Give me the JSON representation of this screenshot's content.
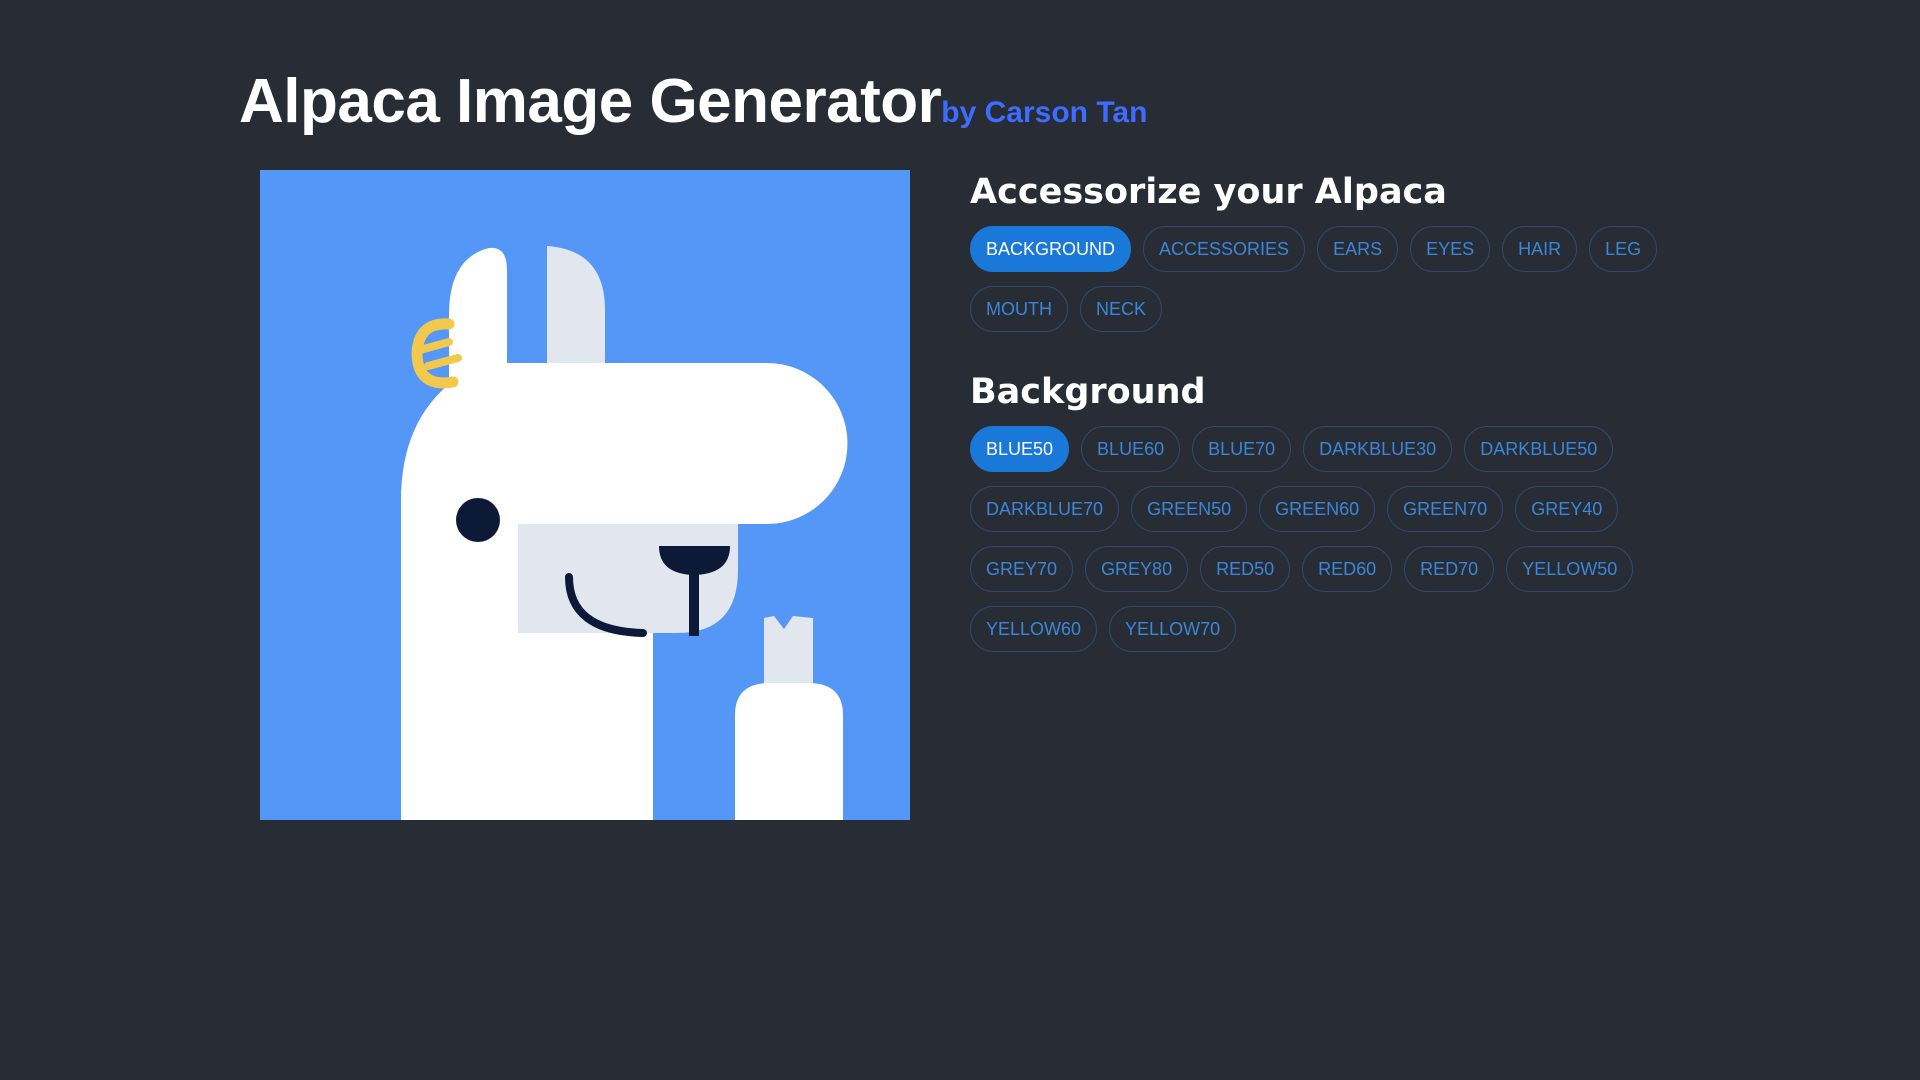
{
  "header": {
    "title": "Alpaca Image Generator",
    "author": "by Carson Tan"
  },
  "preview": {
    "background_color": "#5597f7",
    "accessory_icon": "earring-icon"
  },
  "accessorize": {
    "title": "Accessorize your Alpaca",
    "options": [
      "BACKGROUND",
      "ACCESSORIES",
      "EARS",
      "EYES",
      "HAIR",
      "LEG",
      "MOUTH",
      "NECK"
    ],
    "selected": "BACKGROUND"
  },
  "background": {
    "title": "Background",
    "options": [
      "BLUE50",
      "BLUE60",
      "BLUE70",
      "DARKBLUE30",
      "DARKBLUE50",
      "DARKBLUE70",
      "GREEN50",
      "GREEN60",
      "GREEN70",
      "GREY40",
      "GREY70",
      "GREY80",
      "RED50",
      "RED60",
      "RED70",
      "YELLOW50",
      "YELLOW60",
      "YELLOW70"
    ],
    "selected": "BLUE50"
  },
  "colors": {
    "page_background": "#282c34",
    "accent": "#1a78d8",
    "author": "#3d6cff"
  }
}
